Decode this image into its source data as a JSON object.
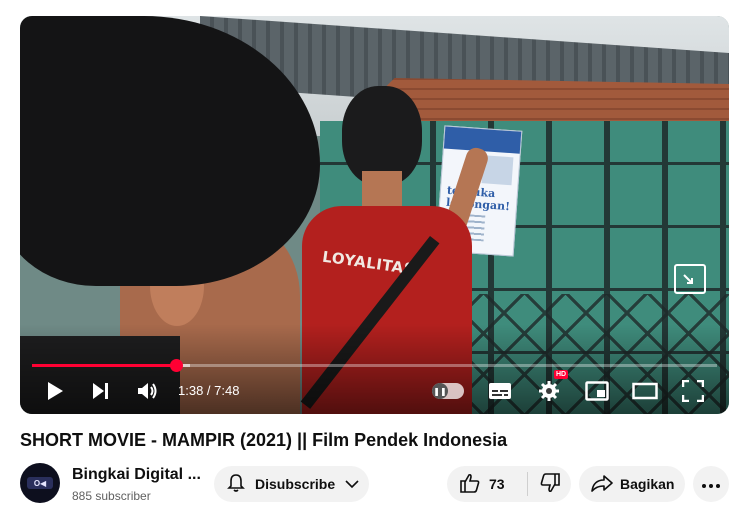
{
  "player": {
    "current_time": "1:38",
    "separator": "/",
    "duration": "7:48",
    "time_display": "1:38 / 7:48",
    "progress_played_fraction": 0.21,
    "progress_buffered_fraction": 0.23,
    "hd_badge": "HD",
    "scene_text": {
      "shirt_print": "LOYALITAS",
      "poster_title": "terbuka lowongan!"
    },
    "icons": {
      "play": "play-icon",
      "next": "next-icon",
      "volume": "volume-icon",
      "autoplay": "autoplay-toggle",
      "captions": "subtitles-icon",
      "settings": "gear-icon",
      "miniplayer": "miniplayer-icon",
      "theater": "theater-icon",
      "fullscreen": "fullscreen-icon"
    }
  },
  "video": {
    "title": "SHORT MOVIE - MAMPIR (2021) || Film Pendek Indonesia"
  },
  "channel": {
    "name": "Bingkai Digital ...",
    "subscribers": "885 subscriber"
  },
  "actions": {
    "subscribe_label": "Disubscribe",
    "like_count": "73",
    "share_label": "Bagikan"
  },
  "colors": {
    "accent": "#ff0033",
    "pill_bg": "#f2f2f2",
    "secondary_text": "#606060"
  }
}
